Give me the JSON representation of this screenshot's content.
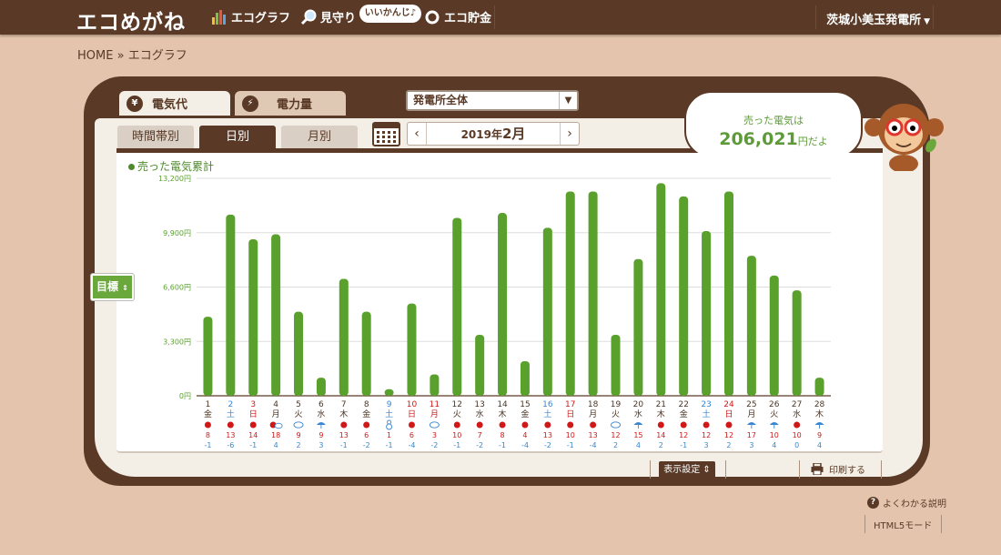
{
  "header": {
    "logo": "エコめがね",
    "nav": [
      {
        "label": "エコグラフ"
      },
      {
        "label": "見守り"
      },
      {
        "label": "エコ貯金"
      }
    ],
    "bubble": "いいかんじ♪",
    "plant": "茨城小美玉発電所"
  },
  "breadcrumb": {
    "home": "HOME",
    "sep": "»",
    "current": "エコグラフ"
  },
  "tabs": {
    "cost": "電気代",
    "power": "電力量"
  },
  "area_select": "発電所全体",
  "period_tabs": [
    "時間帯別",
    "日別",
    "月別"
  ],
  "month_nav": {
    "prev": "‹",
    "year": "2019年",
    "month": "2月",
    "next": "›"
  },
  "sold": {
    "label": "売った電気は",
    "value": "206,021",
    "suffix": "円だよ"
  },
  "legend": "売った電気累計",
  "goal_button": "目標",
  "display_settings": "表示設定",
  "print": "印刷する",
  "help": "よくわかる説明",
  "html5": "HTML5モード",
  "colors": {
    "bar": "#5aa02c",
    "brown": "#5a3a26",
    "sat": "#3a86d0",
    "sun": "#d01818"
  },
  "chart_data": {
    "type": "bar",
    "ylim": [
      0,
      13200
    ],
    "yticks": [
      "0円",
      "3,300円",
      "6,600円",
      "9,900円",
      "13,200円"
    ],
    "days": [
      "1",
      "2",
      "3",
      "4",
      "5",
      "6",
      "7",
      "8",
      "9",
      "10",
      "11",
      "12",
      "13",
      "14",
      "15",
      "16",
      "17",
      "18",
      "19",
      "20",
      "21",
      "22",
      "23",
      "24",
      "25",
      "26",
      "27",
      "28"
    ],
    "weekdays": [
      "金",
      "土",
      "日",
      "月",
      "火",
      "水",
      "木",
      "金",
      "土",
      "日",
      "月",
      "火",
      "水",
      "木",
      "金",
      "土",
      "日",
      "月",
      "火",
      "水",
      "木",
      "金",
      "土",
      "日",
      "月",
      "火",
      "水",
      "木"
    ],
    "day_colors": [
      "n",
      "sat",
      "sun",
      "n",
      "n",
      "n",
      "n",
      "n",
      "sat",
      "sun",
      "sun",
      "n",
      "n",
      "n",
      "n",
      "sat",
      "sun",
      "n",
      "n",
      "n",
      "n",
      "n",
      "sat",
      "sun",
      "n",
      "n",
      "n",
      "n"
    ],
    "values": [
      4800,
      11000,
      9500,
      9800,
      5100,
      1100,
      7100,
      5100,
      400,
      5600,
      1300,
      10800,
      3700,
      11100,
      2100,
      10200,
      12400,
      12400,
      3700,
      8300,
      12900,
      12100,
      10000,
      12400,
      8500,
      7300,
      6400,
      1100
    ],
    "weather": [
      "sun",
      "sun",
      "sun",
      "sun-cloud",
      "cloud",
      "rain",
      "sun",
      "sun",
      "snow",
      "sun",
      "cloud",
      "sun",
      "sun",
      "sun",
      "sun",
      "sun",
      "sun",
      "sun",
      "cloud",
      "rain",
      "sun",
      "sun",
      "sun",
      "sun",
      "rain",
      "rain",
      "sun",
      "rain"
    ],
    "temp_high": [
      "8",
      "13",
      "14",
      "18",
      "9",
      "9",
      "13",
      "6",
      "1",
      "6",
      "3",
      "10",
      "7",
      "8",
      "4",
      "13",
      "10",
      "13",
      "12",
      "15",
      "14",
      "12",
      "12",
      "12",
      "17",
      "10",
      "10",
      "9"
    ],
    "temp_low": [
      "-1",
      "-6",
      "-1",
      "4",
      "2",
      "3",
      "-1",
      "-2",
      "-1",
      "-4",
      "-2",
      "-1",
      "-2",
      "-1",
      "-4",
      "-2",
      "-1",
      "-4",
      "2",
      "4",
      "2",
      "-1",
      "3",
      "2",
      "3",
      "4",
      "0",
      "4"
    ]
  }
}
